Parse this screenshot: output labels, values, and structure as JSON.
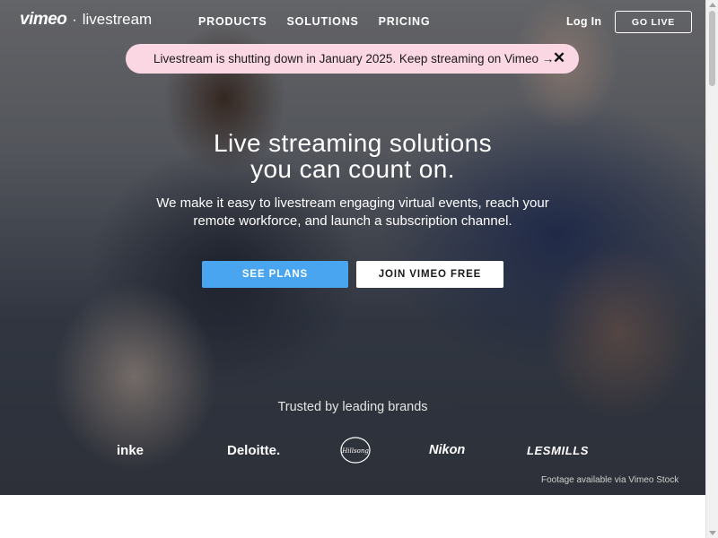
{
  "brand": {
    "vimeo": "vimeo",
    "separator": "·",
    "livestream": "livestream"
  },
  "nav": [
    {
      "label": "PRODUCTS"
    },
    {
      "label": "SOLUTIONS"
    },
    {
      "label": "PRICING"
    }
  ],
  "header": {
    "login": "Log In",
    "go_live": "GO LIVE"
  },
  "banner": {
    "text": "Livestream is shutting down in January 2025. Keep streaming on Vimeo →",
    "close": "✕"
  },
  "hero": {
    "headline_line1": "Live streaming solutions",
    "headline_line2": "you can count on.",
    "subhead_line1": "We make it easy to livestream engaging virtual events, reach your",
    "subhead_line2": "remote workforce, and launch a subscription channel.",
    "see_plans": "SEE PLANS",
    "join_free": "JOIN VIMEO FREE"
  },
  "trusted": {
    "title": "Trusted by leading brands",
    "brands": [
      "inke",
      "Deloitte.",
      "Hillsong",
      "Nikon",
      "LESMILLS"
    ]
  },
  "footage_credit": "Footage available via Vimeo Stock"
}
